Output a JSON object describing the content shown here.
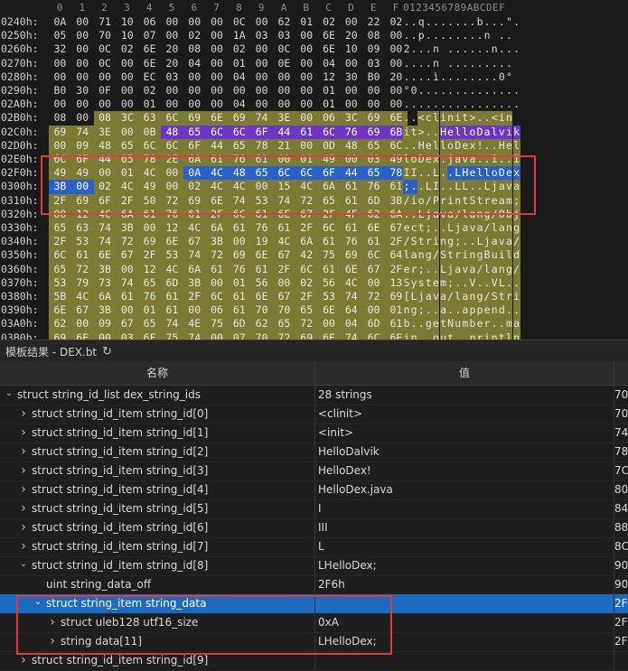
{
  "hex": {
    "col_header": [
      "0",
      "1",
      "2",
      "3",
      "4",
      "5",
      "6",
      "7",
      "8",
      "9",
      "A",
      "B",
      "C",
      "D",
      "E",
      "F"
    ],
    "char_header": "0123456789ABCDEF",
    "rows": [
      {
        "addr": "0240h:",
        "b": [
          "0A",
          "00",
          "71",
          "10",
          "06",
          "00",
          "00",
          "00",
          "0C",
          "00",
          "62",
          "01",
          "02",
          "00",
          "22",
          "02"
        ],
        "c": "..q.......b...\"."
      },
      {
        "addr": "0250h:",
        "b": [
          "05",
          "00",
          "70",
          "10",
          "07",
          "00",
          "02",
          "00",
          "1A",
          "03",
          "03",
          "00",
          "6E",
          "20",
          "08",
          "00"
        ],
        "c": "..p........n .."
      },
      {
        "addr": "0260h:",
        "b": [
          "32",
          "00",
          "0C",
          "02",
          "6E",
          "20",
          "08",
          "00",
          "02",
          "00",
          "0C",
          "00",
          "6E",
          "10",
          "09",
          "00"
        ],
        "c": "2...n ......n..."
      },
      {
        "addr": "0270h:",
        "b": [
          "00",
          "00",
          "0C",
          "00",
          "6E",
          "20",
          "04",
          "00",
          "01",
          "00",
          "0E",
          "00",
          "04",
          "00",
          "03",
          "00"
        ],
        "c": "....n ........."
      },
      {
        "addr": "0280h:",
        "b": [
          "00",
          "00",
          "00",
          "00",
          "EC",
          "03",
          "00",
          "00",
          "04",
          "00",
          "00",
          "00",
          "12",
          "30",
          "B0",
          "20"
        ],
        "c": "....ì........0° "
      },
      {
        "addr": "0290h:",
        "b": [
          "B0",
          "30",
          "0F",
          "00",
          "02",
          "00",
          "00",
          "00",
          "00",
          "00",
          "00",
          "00",
          "01",
          "00",
          "00",
          "00"
        ],
        "c": "°0.............."
      },
      {
        "addr": "02A0h:",
        "b": [
          "00",
          "00",
          "00",
          "00",
          "01",
          "00",
          "00",
          "00",
          "04",
          "00",
          "00",
          "00",
          "01",
          "00",
          "00",
          "00"
        ],
        "c": "................"
      },
      {
        "addr": "02B0h:",
        "b": [
          "08",
          "00",
          "08",
          "3C",
          "63",
          "6C",
          "69",
          "6E",
          "69",
          "74",
          "3E",
          "00",
          "06",
          "3C",
          "69",
          "6E"
        ],
        "c": "..<clinit>..<in"
      },
      {
        "addr": "02C0h:",
        "b": [
          "69",
          "74",
          "3E",
          "00",
          "0B",
          "48",
          "65",
          "6C",
          "6C",
          "6F",
          "44",
          "61",
          "6C",
          "76",
          "69",
          "6B"
        ],
        "c": "it>..HelloDalvik"
      },
      {
        "addr": "02D0h:",
        "b": [
          "00",
          "09",
          "48",
          "65",
          "6C",
          "6C",
          "6F",
          "44",
          "65",
          "78",
          "21",
          "00",
          "0D",
          "48",
          "65",
          "6C"
        ],
        "c": "..HelloDex!..Hel"
      },
      {
        "addr": "02E0h:",
        "b": [
          "6C",
          "6F",
          "44",
          "65",
          "78",
          "2E",
          "6A",
          "61",
          "76",
          "61",
          "00",
          "01",
          "49",
          "00",
          "03",
          "49"
        ],
        "c": "loDex.java..I..I"
      },
      {
        "addr": "02F0h:",
        "b": [
          "49",
          "49",
          "00",
          "01",
          "4C",
          "00",
          "0A",
          "4C",
          "48",
          "65",
          "6C",
          "6C",
          "6F",
          "44",
          "65",
          "78"
        ],
        "c": "II..L..LHelloDex"
      },
      {
        "addr": "0300h:",
        "b": [
          "3B",
          "00",
          "02",
          "4C",
          "49",
          "00",
          "02",
          "4C",
          "4C",
          "00",
          "15",
          "4C",
          "6A",
          "61",
          "76",
          "61"
        ],
        "c": ";..LI..LL..Ljava"
      },
      {
        "addr": "0310h:",
        "b": [
          "2F",
          "69",
          "6F",
          "2F",
          "50",
          "72",
          "69",
          "6E",
          "74",
          "53",
          "74",
          "72",
          "65",
          "61",
          "6D",
          "3B"
        ],
        "c": "/io/PrintStream;"
      },
      {
        "addr": "0320h:",
        "b": [
          "00",
          "12",
          "4C",
          "6A",
          "61",
          "76",
          "61",
          "2F",
          "6C",
          "61",
          "6E",
          "67",
          "2F",
          "4F",
          "62",
          "6A"
        ],
        "c": "..Ljava/lang/Obj"
      },
      {
        "addr": "0330h:",
        "b": [
          "65",
          "63",
          "74",
          "3B",
          "00",
          "12",
          "4C",
          "6A",
          "61",
          "76",
          "61",
          "2F",
          "6C",
          "61",
          "6E",
          "67"
        ],
        "c": "ect;..Ljava/lang"
      },
      {
        "addr": "0340h:",
        "b": [
          "2F",
          "53",
          "74",
          "72",
          "69",
          "6E",
          "67",
          "3B",
          "00",
          "19",
          "4C",
          "6A",
          "61",
          "76",
          "61",
          "2F"
        ],
        "c": "/String;..Ljava/"
      },
      {
        "addr": "0350h:",
        "b": [
          "6C",
          "61",
          "6E",
          "67",
          "2F",
          "53",
          "74",
          "72",
          "69",
          "6E",
          "67",
          "42",
          "75",
          "69",
          "6C",
          "64"
        ],
        "c": "lang/StringBuild"
      },
      {
        "addr": "0360h:",
        "b": [
          "65",
          "72",
          "3B",
          "00",
          "12",
          "4C",
          "6A",
          "61",
          "76",
          "61",
          "2F",
          "6C",
          "61",
          "6E",
          "67",
          "2F"
        ],
        "c": "er;..Ljava/lang/"
      },
      {
        "addr": "0370h:",
        "b": [
          "53",
          "79",
          "73",
          "74",
          "65",
          "6D",
          "3B",
          "00",
          "01",
          "56",
          "00",
          "02",
          "56",
          "4C",
          "00",
          "13"
        ],
        "c": "System;..V..VL.."
      },
      {
        "addr": "0380h:",
        "b": [
          "5B",
          "4C",
          "6A",
          "61",
          "76",
          "61",
          "2F",
          "6C",
          "61",
          "6E",
          "67",
          "2F",
          "53",
          "74",
          "72",
          "69"
        ],
        "c": "[Ljava/lang/Stri"
      },
      {
        "addr": "0390h:",
        "b": [
          "6E",
          "67",
          "3B",
          "00",
          "01",
          "61",
          "00",
          "06",
          "61",
          "70",
          "70",
          "65",
          "6E",
          "64",
          "00",
          "01"
        ],
        "c": "ng;..a..append.."
      },
      {
        "addr": "03A0h:",
        "b": [
          "62",
          "00",
          "09",
          "67",
          "65",
          "74",
          "4E",
          "75",
          "6D",
          "62",
          "65",
          "72",
          "00",
          "04",
          "6D",
          "61"
        ],
        "c": "b..getNumber..ma"
      },
      {
        "addr": "03B0h:",
        "b": [
          "69",
          "6E",
          "00",
          "03",
          "6F",
          "75",
          "74",
          "00",
          "07",
          "70",
          "72",
          "69",
          "6E",
          "74",
          "6C",
          "6E"
        ],
        "c": "in..out..println"
      }
    ]
  },
  "template_bar": {
    "title": "模板结果 - DEX.bt",
    "refresh_icon": "refresh-icon"
  },
  "columns": {
    "name": "名称",
    "value": "值",
    "start": ""
  },
  "tree": [
    {
      "name": "struct string_id_list dex_string_ids",
      "value": "28 strings",
      "start": "70",
      "indent": 0,
      "chev": "down"
    },
    {
      "name": "struct string_id_item string_id[0]",
      "value": "<clinit>",
      "start": "70",
      "indent": 1,
      "chev": "right"
    },
    {
      "name": "struct string_id_item string_id[1]",
      "value": "<init>",
      "start": "74",
      "indent": 1,
      "chev": "right"
    },
    {
      "name": "struct string_id_item string_id[2]",
      "value": "HelloDalvik",
      "start": "78",
      "indent": 1,
      "chev": "right"
    },
    {
      "name": "struct string_id_item string_id[3]",
      "value": "HelloDex!",
      "start": "7C",
      "indent": 1,
      "chev": "right"
    },
    {
      "name": "struct string_id_item string_id[4]",
      "value": "HelloDex.java",
      "start": "80",
      "indent": 1,
      "chev": "right"
    },
    {
      "name": "struct string_id_item string_id[5]",
      "value": "I",
      "start": "84",
      "indent": 1,
      "chev": "right"
    },
    {
      "name": "struct string_id_item string_id[6]",
      "value": "III",
      "start": "88",
      "indent": 1,
      "chev": "right"
    },
    {
      "name": "struct string_id_item string_id[7]",
      "value": "L",
      "start": "8C",
      "indent": 1,
      "chev": "right"
    },
    {
      "name": "struct string_id_item string_id[8]",
      "value": "LHelloDex;",
      "start": "90",
      "indent": 1,
      "chev": "down"
    },
    {
      "name": "uint string_data_off",
      "value": "2F6h",
      "start": "90",
      "indent": 2,
      "chev": ""
    },
    {
      "name": "struct string_item string_data",
      "value": "",
      "start": "2F",
      "indent": 2,
      "chev": "down",
      "selected": true
    },
    {
      "name": "struct uleb128 utf16_size",
      "value": "0xA",
      "start": "2F",
      "indent": 3,
      "chev": "right"
    },
    {
      "name": "string data[11]",
      "value": "LHelloDex;",
      "start": "2F",
      "indent": 3,
      "chev": "right"
    },
    {
      "name": "struct string_id_item string_id[9]",
      "value": "",
      "start": "",
      "indent": 1,
      "chev": "right"
    }
  ],
  "colors": {
    "olive": "#7b7b35",
    "blue": "#2961c9",
    "purple": "#6c35c4",
    "frame": "#e23b3b",
    "selected": "#1d6bc0"
  }
}
